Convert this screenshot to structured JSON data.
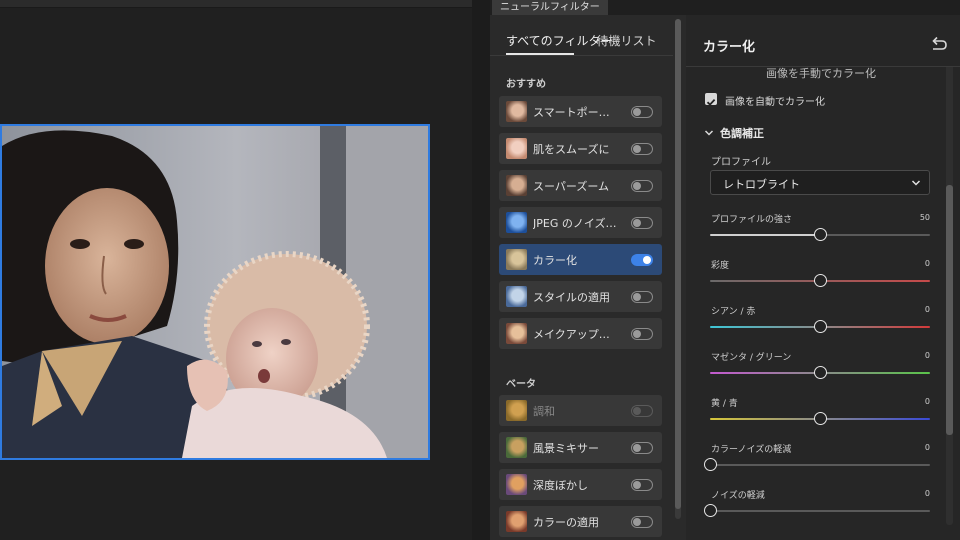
{
  "panel": {
    "tab_title": "ニューラルフィルター"
  },
  "filter_list": {
    "tab_label": "すべてのフィルター",
    "waitlist_label": "待機リスト",
    "sections": {
      "recommended": "おすすめ",
      "beta": "ベータ"
    },
    "items": [
      {
        "name": "スマートポートレート",
        "label": "スマートポー…",
        "enabled": false,
        "active": false,
        "disabled": false,
        "icon": "portrait-thumb-icon"
      },
      {
        "name": "肌をスムーズに",
        "label": "肌をスムーズに",
        "enabled": false,
        "active": false,
        "disabled": false,
        "icon": "skin-thumb-icon"
      },
      {
        "name": "スーパーズーム",
        "label": "スーパーズーム",
        "enabled": false,
        "active": false,
        "disabled": false,
        "icon": "zoom-thumb-icon"
      },
      {
        "name": "JPEG のノイズを削除",
        "label": "JPEG のノイズ…",
        "enabled": false,
        "active": false,
        "disabled": false,
        "icon": "jpeg-thumb-icon"
      },
      {
        "name": "カラー化",
        "label": "カラー化",
        "enabled": true,
        "active": true,
        "disabled": false,
        "icon": "colorize-thumb-icon"
      },
      {
        "name": "スタイルの適用",
        "label": "スタイルの適用",
        "enabled": false,
        "active": false,
        "disabled": false,
        "icon": "style-thumb-icon"
      },
      {
        "name": "メイクアップ",
        "label": "メイクアップ…",
        "enabled": false,
        "active": false,
        "disabled": false,
        "icon": "makeup-thumb-icon"
      },
      {
        "name": "調和",
        "label": "調和",
        "enabled": false,
        "active": false,
        "disabled": true,
        "icon": "harmony-thumb-icon"
      },
      {
        "name": "風景ミキサー",
        "label": "風景ミキサー",
        "enabled": false,
        "active": false,
        "disabled": false,
        "icon": "landscape-thumb-icon"
      },
      {
        "name": "深度ぼかし",
        "label": "深度ぼかし",
        "enabled": false,
        "active": false,
        "disabled": false,
        "icon": "depth-thumb-icon"
      },
      {
        "name": "カラーの適用",
        "label": "カラーの適用",
        "enabled": false,
        "active": false,
        "disabled": false,
        "icon": "color-transfer-thumb-icon"
      }
    ]
  },
  "settings": {
    "title": "カラー化",
    "clipped_heading": "画像を手動でカラー化",
    "auto_colorize_label": "画像を自動でカラー化",
    "auto_colorize_checked": true,
    "section_title": "色調補正",
    "profile_label": "プロファイル",
    "profile_value": "レトロブライト",
    "sliders": [
      {
        "label": "プロファイルの強さ",
        "value": "50",
        "fraction": 0.5,
        "gradient": "neutral"
      },
      {
        "label": "彩度",
        "value": "0",
        "fraction": 0.5,
        "gradient": "saturation"
      },
      {
        "label": "シアン / 赤",
        "value": "0",
        "fraction": 0.5,
        "gradient": "cyan-red"
      },
      {
        "label": "マゼンタ / グリーン",
        "value": "0",
        "fraction": 0.5,
        "gradient": "magenta-green"
      },
      {
        "label": "黄 / 青",
        "value": "0",
        "fraction": 0.5,
        "gradient": "yellow-blue"
      },
      {
        "label": "カラーノイズの軽減",
        "value": "0",
        "fraction": 0.0,
        "gradient": "neutral"
      },
      {
        "label": "ノイズの軽減",
        "value": "0",
        "fraction": 0.0,
        "gradient": "neutral"
      }
    ]
  },
  "colors": {
    "accent": "#3d82e8",
    "active_item": "#2c4a77",
    "selection_border": "#2f7be0"
  }
}
